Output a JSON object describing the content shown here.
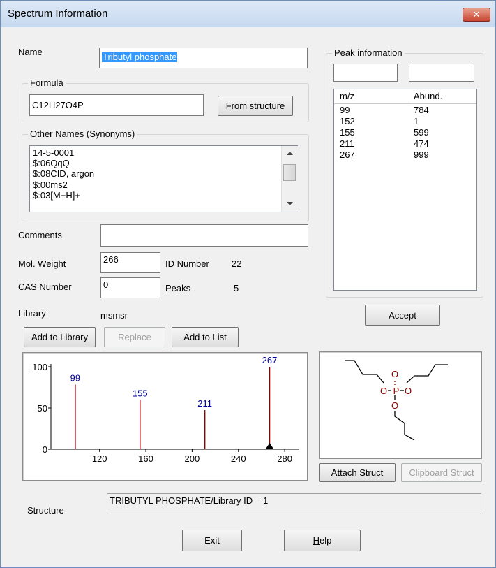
{
  "window": {
    "title": "Spectrum Information",
    "close_glyph": "✕"
  },
  "name": {
    "label": "Name",
    "value": "Tributyl phosphate"
  },
  "formula": {
    "group_title": "Formula",
    "value": "C12H27O4P",
    "button": "From structure"
  },
  "synonyms": {
    "group_title": "Other Names (Synonyms)",
    "items": [
      "14-5-0001",
      "$:06QqQ",
      "$:08CID, argon",
      "$:00ms2",
      "$:03[M+H]+"
    ]
  },
  "comments": {
    "label": "Comments",
    "value": ""
  },
  "mol_weight": {
    "label": "Mol. Weight",
    "value": "266"
  },
  "id_number": {
    "label": "ID Number",
    "value": "22"
  },
  "cas_number": {
    "label": "CAS Number",
    "value": "0"
  },
  "peaks": {
    "label": "Peaks",
    "value": "5"
  },
  "library": {
    "label": "Library",
    "value": "msmsr"
  },
  "buttons": {
    "add_to_library": "Add to Library",
    "replace": "Replace",
    "add_to_list": "Add to List",
    "accept": "Accept",
    "attach_struct": "Attach Struct",
    "clipboard_struct": "Clipboard Struct",
    "exit": "Exit",
    "help": "Help"
  },
  "peak_info": {
    "group_title": "Peak information",
    "input1": "",
    "input2": "",
    "col_mz": "m/z",
    "col_abund": "Abund.",
    "rows": [
      {
        "mz": "99",
        "abund": "784"
      },
      {
        "mz": "152",
        "abund": "1"
      },
      {
        "mz": "155",
        "abund": "599"
      },
      {
        "mz": "211",
        "abund": "474"
      },
      {
        "mz": "267",
        "abund": "999"
      }
    ]
  },
  "structure_label": "Structure",
  "structure_value": "TRIBUTYL PHOSPHATE/Library ID = 1",
  "molecule": {
    "atom_o": "O",
    "atom_p": "P"
  },
  "colors": {
    "peak": "#8b0000",
    "peak_label": "#0000a0",
    "selection": "#3399ff"
  },
  "chart_data": {
    "type": "bar",
    "x": [
      99,
      152,
      155,
      211,
      267
    ],
    "values": [
      784,
      1,
      599,
      474,
      999
    ],
    "peak_labels": [
      "99",
      "155",
      "211",
      "267"
    ],
    "xlim": [
      78,
      292
    ],
    "ylim": [
      0,
      1000
    ],
    "x_ticks": [
      120,
      160,
      200,
      240,
      280
    ],
    "y_ticks": [
      0,
      50,
      100
    ],
    "y_tick_values": [
      0,
      500,
      1000
    ],
    "marker_x": 267
  }
}
